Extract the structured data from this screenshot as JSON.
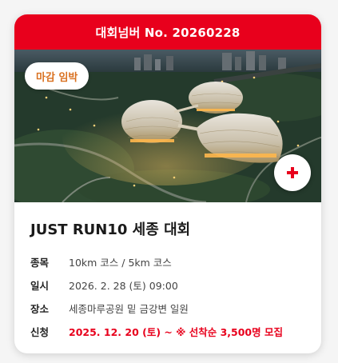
{
  "header": {
    "title": "대회넘버 No. 20260228"
  },
  "photo": {
    "badge": "마감 임박",
    "fav_icon": "plus-icon",
    "fav_color": "#e8001c"
  },
  "event": {
    "title": "JUST RUN10 세종 대회",
    "details": [
      {
        "label": "종목",
        "value": "10km 코스 / 5km 코스",
        "highlight": false
      },
      {
        "label": "일시",
        "value": "2026. 2. 28 (토) 09:00",
        "highlight": false
      },
      {
        "label": "장소",
        "value": "세종마루공원 밑 금강변 일원",
        "highlight": false
      },
      {
        "label": "신청",
        "value": "2025. 12. 20 (토) ~ ※ 선착순 3,500명 모집",
        "highlight": true
      }
    ]
  },
  "colors": {
    "accent": "#e8001c",
    "badge_text": "#d9701f"
  }
}
